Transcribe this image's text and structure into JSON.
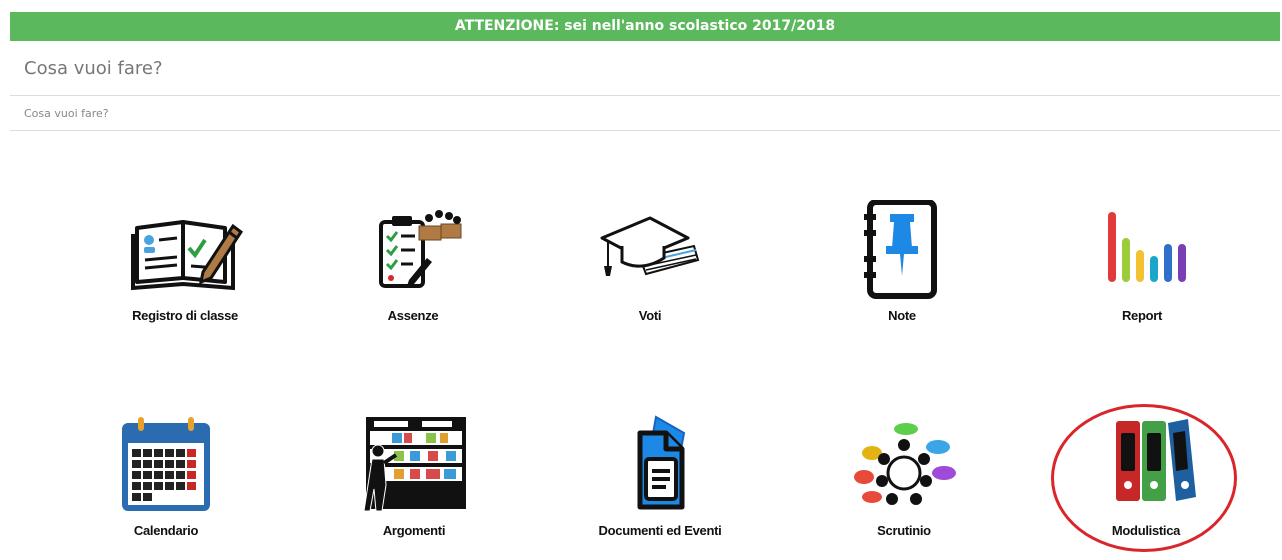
{
  "banner": {
    "text": "ATTENZIONE: sei nell'anno scolastico 2017/2018"
  },
  "header": {
    "title": "Cosa vuoi fare?"
  },
  "breadcrumb": {
    "text": "Cosa vuoi fare?"
  },
  "tiles": [
    {
      "label": "Registro di classe",
      "icon": "open-book-pencil-icon"
    },
    {
      "label": "Assenze",
      "icon": "attendance-checklist-icon"
    },
    {
      "label": "Voti",
      "icon": "graduation-cap-icon"
    },
    {
      "label": "Note",
      "icon": "notebook-pushpin-icon"
    },
    {
      "label": "Report",
      "icon": "bar-chart-icon"
    },
    {
      "label": "Calendario",
      "icon": "calendar-icon"
    },
    {
      "label": "Argomenti",
      "icon": "teacher-blackboard-icon"
    },
    {
      "label": "Documenti ed Eventi",
      "icon": "document-ticket-icon"
    },
    {
      "label": "Scrutinio",
      "icon": "meeting-table-icon"
    },
    {
      "label": "Modulistica",
      "icon": "binders-icon"
    }
  ],
  "colors": {
    "banner_bg": "#5cb85c",
    "highlight": "#d9262b",
    "note_blue": "#1e88e5",
    "calendar_blue": "#2b6cb0",
    "binder_red": "#c62828",
    "binder_green": "#43a047",
    "binder_blue": "#1e5fa0"
  }
}
